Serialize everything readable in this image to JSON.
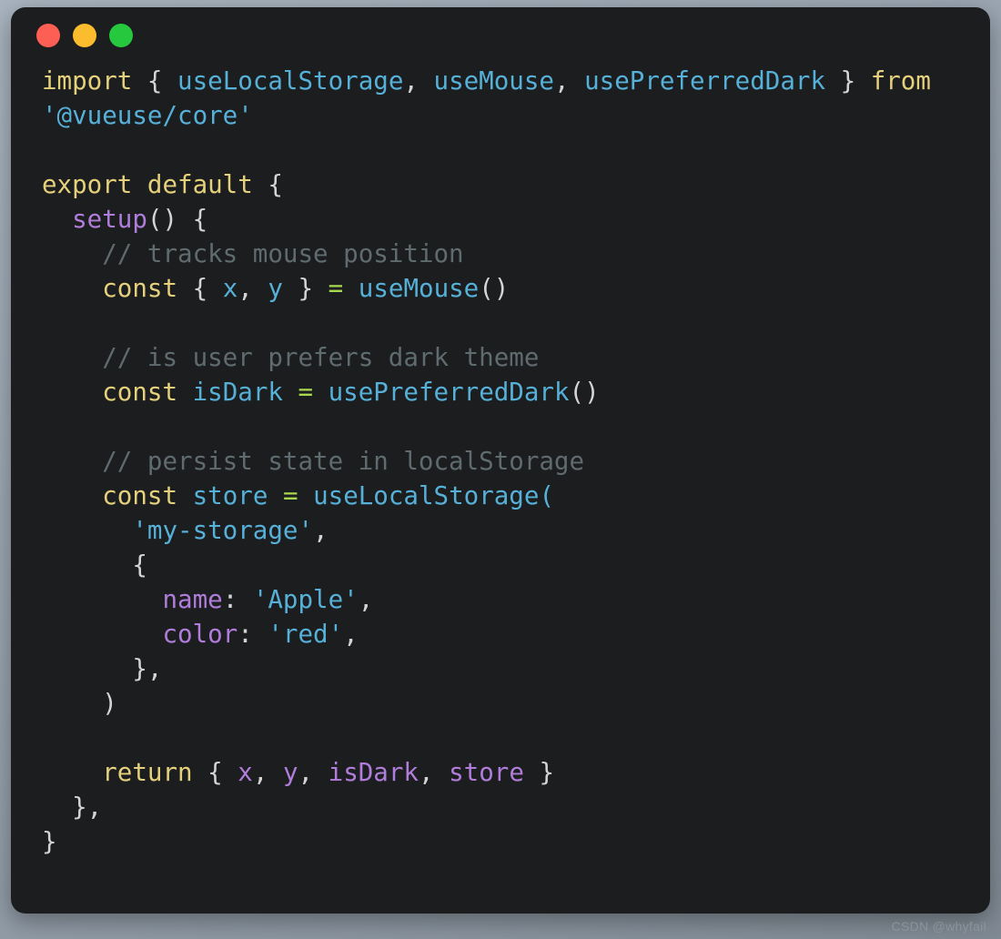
{
  "window": {
    "traffic_lights": [
      {
        "name": "close",
        "color": "#fd5f55"
      },
      {
        "name": "minimize",
        "color": "#fbbd2d"
      },
      {
        "name": "maximize",
        "color": "#26c93e"
      }
    ]
  },
  "theme": {
    "background": "#1b1d1e",
    "page_background": "#9aa5b1",
    "keyword": "#e5d07b",
    "function": "#b07ddb",
    "identifier": "#56b0d8",
    "string": "#56b0d8",
    "operator": "#a8d84f",
    "punctuation": "#d4d4d4",
    "comment": "#5f6b6f"
  },
  "code": {
    "language": "javascript",
    "lines": [
      [
        {
          "t": "import",
          "c": "kw"
        },
        {
          "t": " ",
          "c": "pun"
        },
        {
          "t": "{",
          "c": "pun"
        },
        {
          "t": " ",
          "c": "pun"
        },
        {
          "t": "useLocalStorage",
          "c": "id"
        },
        {
          "t": ",",
          "c": "pun"
        },
        {
          "t": " ",
          "c": "pun"
        },
        {
          "t": "useMouse",
          "c": "id"
        },
        {
          "t": ",",
          "c": "pun"
        },
        {
          "t": " ",
          "c": "pun"
        },
        {
          "t": "usePreferredDark",
          "c": "id"
        },
        {
          "t": " ",
          "c": "pun"
        },
        {
          "t": "}",
          "c": "pun"
        },
        {
          "t": " ",
          "c": "pun"
        },
        {
          "t": "from",
          "c": "kw"
        }
      ],
      [
        {
          "t": "'@vueuse/core'",
          "c": "str"
        }
      ],
      [],
      [
        {
          "t": "export default",
          "c": "kw"
        },
        {
          "t": " ",
          "c": "pun"
        },
        {
          "t": "{",
          "c": "pun"
        }
      ],
      [
        {
          "t": "  ",
          "c": "pun"
        },
        {
          "t": "setup",
          "c": "fn"
        },
        {
          "t": "()",
          "c": "pun"
        },
        {
          "t": " ",
          "c": "pun"
        },
        {
          "t": "{",
          "c": "pun"
        }
      ],
      [
        {
          "t": "    ",
          "c": "pun"
        },
        {
          "t": "// tracks mouse position",
          "c": "cmt"
        }
      ],
      [
        {
          "t": "    ",
          "c": "pun"
        },
        {
          "t": "const",
          "c": "kw"
        },
        {
          "t": " ",
          "c": "pun"
        },
        {
          "t": "{",
          "c": "pun"
        },
        {
          "t": " ",
          "c": "pun"
        },
        {
          "t": "x",
          "c": "id"
        },
        {
          "t": ",",
          "c": "pun"
        },
        {
          "t": " ",
          "c": "pun"
        },
        {
          "t": "y",
          "c": "id"
        },
        {
          "t": " ",
          "c": "pun"
        },
        {
          "t": "}",
          "c": "pun"
        },
        {
          "t": " ",
          "c": "pun"
        },
        {
          "t": "=",
          "c": "op"
        },
        {
          "t": " ",
          "c": "pun"
        },
        {
          "t": "useMouse",
          "c": "id"
        },
        {
          "t": "()",
          "c": "pun"
        }
      ],
      [],
      [
        {
          "t": "    ",
          "c": "pun"
        },
        {
          "t": "// is user prefers dark theme",
          "c": "cmt"
        }
      ],
      [
        {
          "t": "    ",
          "c": "pun"
        },
        {
          "t": "const",
          "c": "kw"
        },
        {
          "t": " ",
          "c": "pun"
        },
        {
          "t": "isDark",
          "c": "id"
        },
        {
          "t": " ",
          "c": "pun"
        },
        {
          "t": "=",
          "c": "op"
        },
        {
          "t": " ",
          "c": "pun"
        },
        {
          "t": "usePreferredDark",
          "c": "id"
        },
        {
          "t": "()",
          "c": "pun"
        }
      ],
      [],
      [
        {
          "t": "    ",
          "c": "pun"
        },
        {
          "t": "// persist state in localStorage",
          "c": "cmt"
        }
      ],
      [
        {
          "t": "    ",
          "c": "pun"
        },
        {
          "t": "const",
          "c": "kw"
        },
        {
          "t": " ",
          "c": "pun"
        },
        {
          "t": "store",
          "c": "id"
        },
        {
          "t": " ",
          "c": "pun"
        },
        {
          "t": "=",
          "c": "op"
        },
        {
          "t": " ",
          "c": "pun"
        },
        {
          "t": "useLocalStorage",
          "c": "id"
        },
        {
          "t": "(",
          "c": "id"
        }
      ],
      [
        {
          "t": "      ",
          "c": "pun"
        },
        {
          "t": "'my-storage'",
          "c": "str"
        },
        {
          "t": ",",
          "c": "pun"
        }
      ],
      [
        {
          "t": "      ",
          "c": "pun"
        },
        {
          "t": "{",
          "c": "pun"
        }
      ],
      [
        {
          "t": "        ",
          "c": "pun"
        },
        {
          "t": "name",
          "c": "fn"
        },
        {
          "t": ": ",
          "c": "pun"
        },
        {
          "t": "'Apple'",
          "c": "str"
        },
        {
          "t": ",",
          "c": "pun"
        }
      ],
      [
        {
          "t": "        ",
          "c": "pun"
        },
        {
          "t": "color",
          "c": "fn"
        },
        {
          "t": ": ",
          "c": "pun"
        },
        {
          "t": "'red'",
          "c": "str"
        },
        {
          "t": ",",
          "c": "pun"
        }
      ],
      [
        {
          "t": "      ",
          "c": "pun"
        },
        {
          "t": "},",
          "c": "pun"
        }
      ],
      [
        {
          "t": "    ",
          "c": "pun"
        },
        {
          "t": ")",
          "c": "pun"
        }
      ],
      [],
      [
        {
          "t": "    ",
          "c": "pun"
        },
        {
          "t": "return",
          "c": "kw"
        },
        {
          "t": " ",
          "c": "pun"
        },
        {
          "t": "{",
          "c": "pun"
        },
        {
          "t": " ",
          "c": "pun"
        },
        {
          "t": "x",
          "c": "fn"
        },
        {
          "t": ",",
          "c": "pun"
        },
        {
          "t": " ",
          "c": "pun"
        },
        {
          "t": "y",
          "c": "fn"
        },
        {
          "t": ",",
          "c": "pun"
        },
        {
          "t": " ",
          "c": "pun"
        },
        {
          "t": "isDark",
          "c": "fn"
        },
        {
          "t": ",",
          "c": "pun"
        },
        {
          "t": " ",
          "c": "pun"
        },
        {
          "t": "store",
          "c": "fn"
        },
        {
          "t": " ",
          "c": "pun"
        },
        {
          "t": "}",
          "c": "pun"
        }
      ],
      [
        {
          "t": "  ",
          "c": "pun"
        },
        {
          "t": "},",
          "c": "pun"
        }
      ],
      [
        {
          "t": "}",
          "c": "pun"
        }
      ]
    ],
    "plain_text": "import { useLocalStorage, useMouse, usePreferredDark } from '@vueuse/core'\n\nexport default {\n  setup() {\n    // tracks mouse position\n    const { x, y } = useMouse()\n\n    // is user prefers dark theme\n    const isDark = usePreferredDark()\n\n    // persist state in localStorage\n    const store = useLocalStorage(\n      'my-storage',\n      {\n        name: 'Apple',\n        color: 'red',\n      },\n    )\n\n    return { x, y, isDark, store }\n  },\n}"
  },
  "watermark": {
    "text": "CSDN @whyfail"
  }
}
